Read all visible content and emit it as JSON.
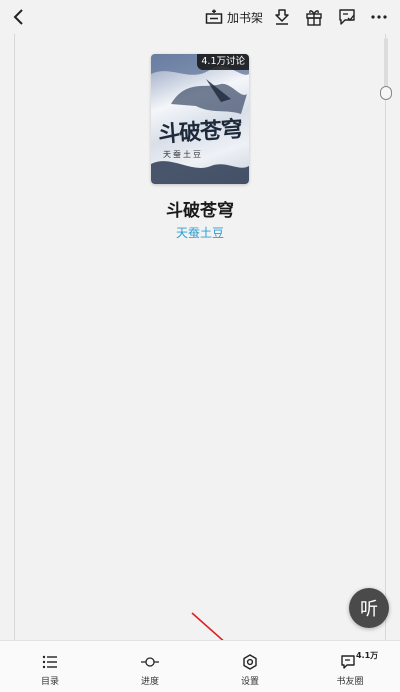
{
  "toolbar": {
    "add_shelf_label": "加书架",
    "icons": [
      "back-icon",
      "add-shelf-icon",
      "download-icon",
      "gift-icon",
      "comment-check-icon",
      "more-icon"
    ]
  },
  "book": {
    "cover_badge": "4.1万讨论",
    "cover_title": "斗破苍穹",
    "cover_author": "天蚕土豆",
    "title": "斗破苍穹",
    "author": "天蚕土豆"
  },
  "listen": {
    "label": "听"
  },
  "bottom_nav": {
    "items": [
      {
        "label": "目录",
        "icon": "list-icon"
      },
      {
        "label": "进度",
        "icon": "progress-icon"
      },
      {
        "label": "设置",
        "icon": "settings-icon"
      },
      {
        "label": "书友圈",
        "icon": "community-icon",
        "badge": "4.1万"
      }
    ]
  },
  "colors": {
    "accent": "#2a9fd6",
    "arrow": "#e02020",
    "listen_bg": "#4a4a4a"
  }
}
